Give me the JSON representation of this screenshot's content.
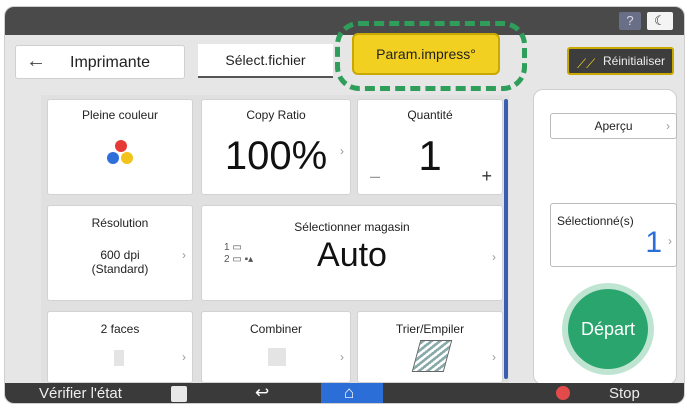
{
  "topbar": {
    "help": "?",
    "night": "☾"
  },
  "header": {
    "back": "←",
    "title": "Imprimante",
    "tabs": [
      {
        "label": "Sélect.fichier"
      },
      {
        "label": "Param.impress°"
      }
    ],
    "reset_label": "Réinitialiser"
  },
  "tiles": {
    "color": {
      "label": "Pleine couleur"
    },
    "copy_ratio": {
      "label": "Copy Ratio",
      "value": "100%"
    },
    "quantity": {
      "label": "Quantité",
      "value": "1",
      "minus": "–",
      "plus": "+"
    },
    "resolution": {
      "label": "Résolution",
      "line1": "600 dpi",
      "line2": "(Standard)"
    },
    "tray": {
      "label": "Sélectionner magasin",
      "value": "Auto"
    },
    "duplex": {
      "label": "2 faces"
    },
    "combine": {
      "label": "Combiner"
    },
    "sort": {
      "label": "Trier/Empiler"
    }
  },
  "side": {
    "preview": "Aperçu",
    "selected_label": "Sélectionné(s)",
    "selected_count": "1",
    "start": "Départ"
  },
  "bottom": {
    "check_status": "Vérifier l'état",
    "stop": "Stop"
  },
  "colors": {
    "accent_yellow": "#f2d021",
    "start_green": "#2aa56e",
    "home_blue": "#2c6ed8",
    "highlight_dash": "#2f9e5a"
  }
}
